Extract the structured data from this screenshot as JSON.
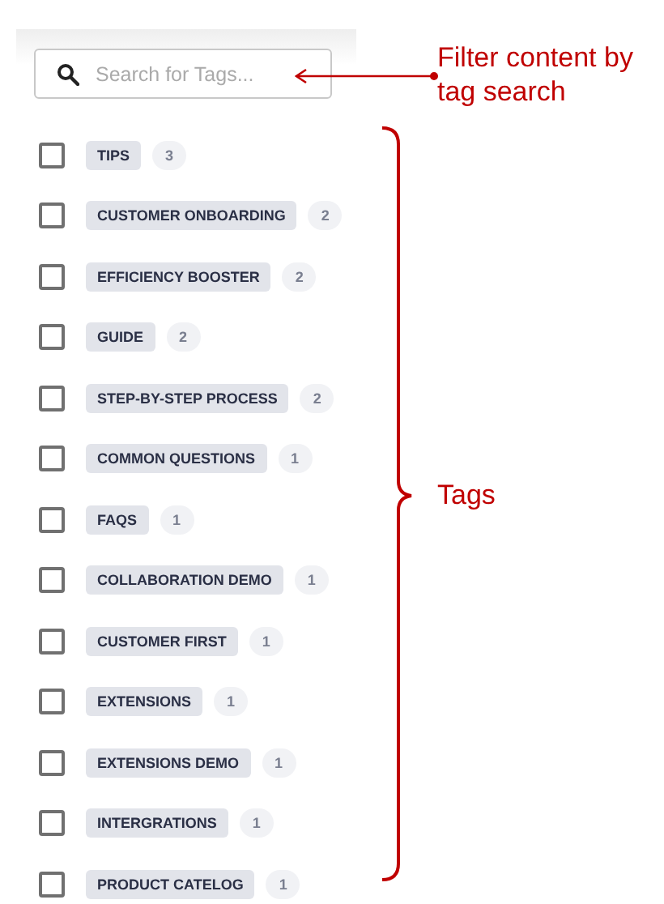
{
  "search": {
    "placeholder": "Search for Tags..."
  },
  "tags": [
    {
      "label": "TIPS",
      "count": "3",
      "checked": false
    },
    {
      "label": "CUSTOMER ONBOARDING",
      "count": "2",
      "checked": false
    },
    {
      "label": "EFFICIENCY BOOSTER",
      "count": "2",
      "checked": false
    },
    {
      "label": "GUIDE",
      "count": "2",
      "checked": false
    },
    {
      "label": "STEP-BY-STEP PROCESS",
      "count": "2",
      "checked": false
    },
    {
      "label": "COMMON QUESTIONS",
      "count": "1",
      "checked": false
    },
    {
      "label": "FAQS",
      "count": "1",
      "checked": false
    },
    {
      "label": "COLLABORATION DEMO",
      "count": "1",
      "checked": false
    },
    {
      "label": "CUSTOMER FIRST",
      "count": "1",
      "checked": false
    },
    {
      "label": "EXTENSIONS",
      "count": "1",
      "checked": false
    },
    {
      "label": "EXTENSIONS DEMO",
      "count": "1",
      "checked": false
    },
    {
      "label": "INTERGRATIONS",
      "count": "1",
      "checked": false
    },
    {
      "label": "PRODUCT CATELOG",
      "count": "1",
      "checked": false
    }
  ],
  "annotations": [
    {
      "kind": "arrow",
      "text": "Filter content by tag search"
    },
    {
      "kind": "bracket",
      "text": "Tags"
    }
  ]
}
